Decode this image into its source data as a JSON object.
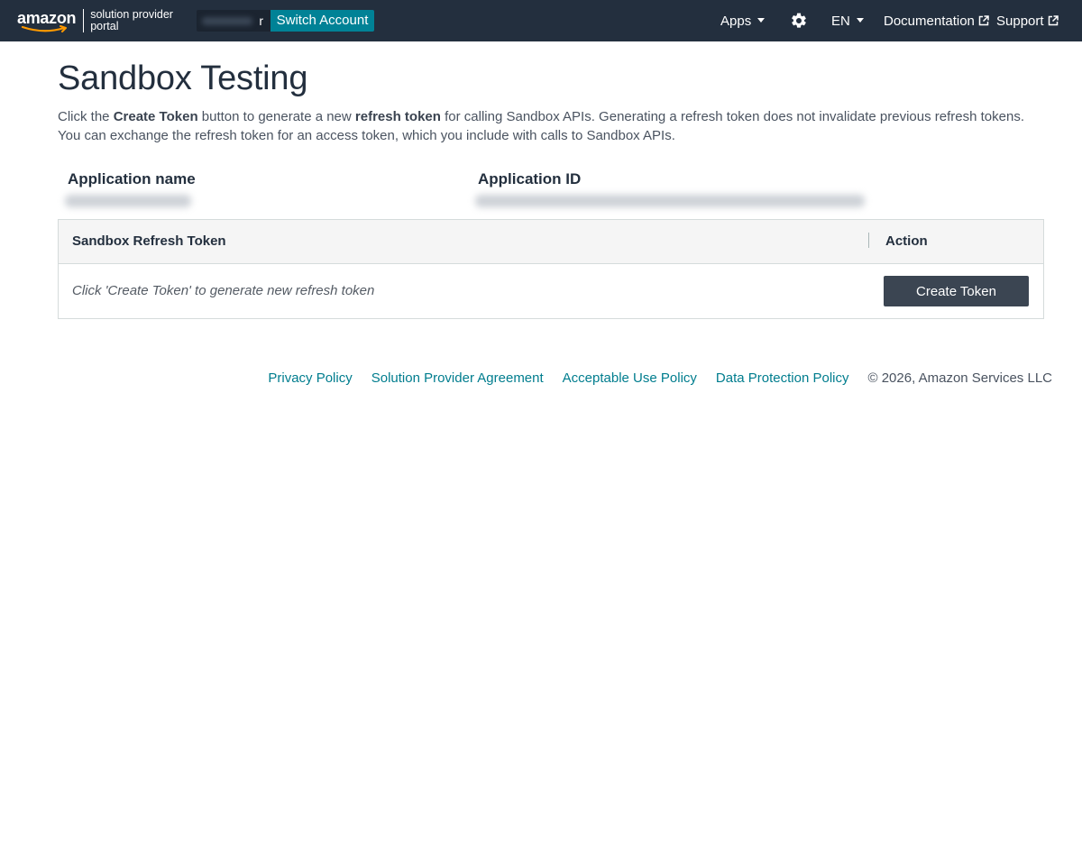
{
  "header": {
    "logo": {
      "brand": "amazon",
      "subtitle": "solution provider\nportal"
    },
    "account": {
      "name_suffix": "r",
      "switch_label": "Switch Account"
    },
    "nav": {
      "apps_label": "Apps",
      "language_label": "EN",
      "documentation_label": "Documentation",
      "support_label": "Support"
    },
    "colors": {
      "bar_bg": "#232f3e",
      "switch_bg": "#008296"
    }
  },
  "main": {
    "title": "Sandbox Testing",
    "intro": {
      "part1": "Click the ",
      "bold1": "Create Token",
      "part2": " button to generate a new ",
      "bold2": "refresh token",
      "part3": " for calling Sandbox APIs. Generating a refresh token does not invalidate previous refresh tokens. You can exchange the refresh token for an access token, which you include with calls to Sandbox APIs."
    },
    "application_name_label": "Application name",
    "application_id_label": "Application ID",
    "token_table": {
      "columns": [
        "Sandbox Refresh Token",
        "Action"
      ],
      "empty_message": "Click 'Create Token' to generate new refresh token",
      "create_button_label": "Create Token"
    }
  },
  "footer": {
    "links": [
      "Privacy Policy",
      "Solution Provider Agreement",
      "Acceptable Use Policy",
      "Data Protection Policy"
    ],
    "copyright": "© 2026, Amazon Services LLC",
    "link_color": "#007d8e"
  }
}
